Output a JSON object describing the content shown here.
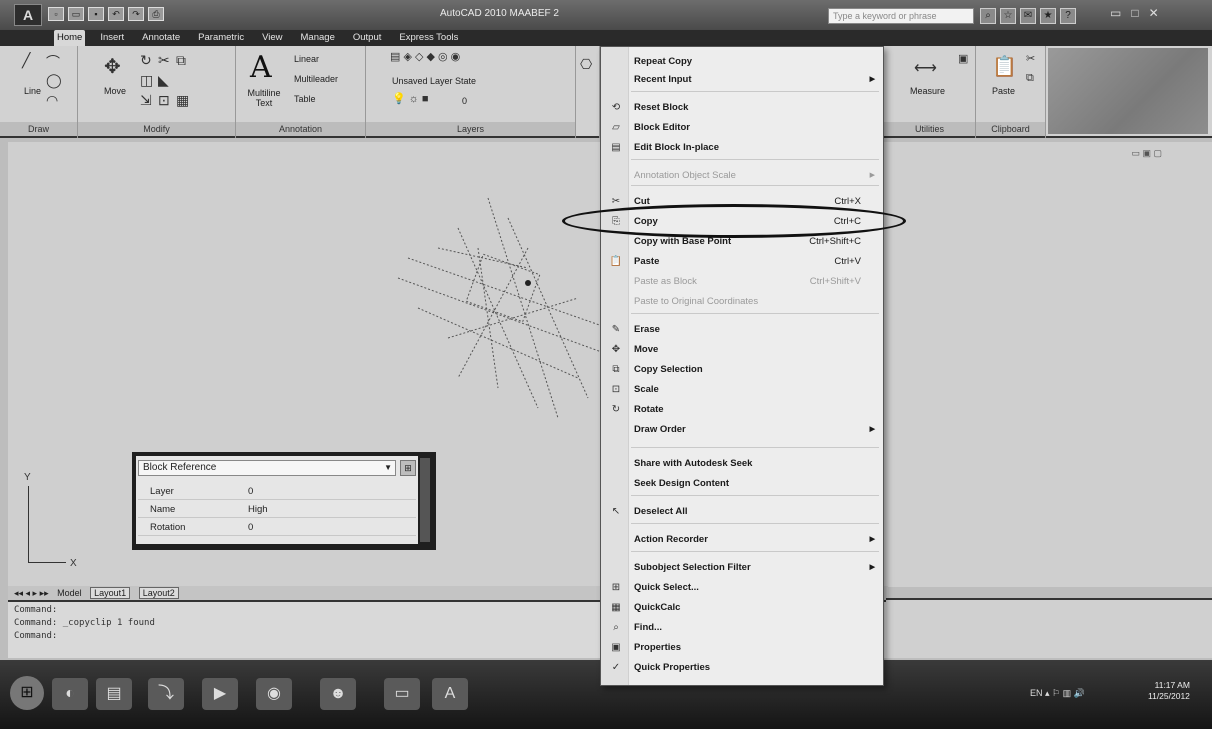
{
  "titlebar": {
    "window_title": "AutoCAD 2010  MAABEF 2",
    "search_placeholder": "Type a keyword or phrase",
    "window_controls": [
      "▭",
      "□",
      "✕"
    ]
  },
  "ribbon_tabs": [
    "Home",
    "Insert",
    "Annotate",
    "Parametric",
    "View",
    "Manage",
    "Output",
    "Express Tools"
  ],
  "ribbon": {
    "draw_tools": {
      "line": "Line"
    },
    "modify_tools": {
      "move": "Move"
    },
    "annotation_tools": {
      "multiline_text": "Multiline Text",
      "linear": "Linear",
      "multileader": "Multileader",
      "table": "Table"
    },
    "layers_tools": {
      "layer_state": "Unsaved Layer State",
      "layer_value": "0"
    },
    "utilities_tools": {
      "measure": "Measure"
    },
    "clipboard_tools": {
      "paste": "Paste"
    },
    "panels": {
      "draw": "Draw",
      "modify": "Modify",
      "annotation": "Annotation",
      "layers": "Layers",
      "utilities": "Utilities",
      "clipboard": "Clipboard"
    }
  },
  "quick_properties": {
    "selected": "Block Reference",
    "rows": [
      {
        "key": "Layer",
        "value": "0"
      },
      {
        "key": "Name",
        "value": "High"
      },
      {
        "key": "Rotation",
        "value": "0"
      }
    ]
  },
  "layout_tabs": [
    "Model",
    "Layout1",
    "Layout2"
  ],
  "command_lines": [
    "Command:",
    "Command: _copyclip 1 found",
    "Command:"
  ],
  "context_menu": {
    "items": [
      {
        "label": "Repeat Copy",
        "shortcut": "",
        "disabled": false,
        "submenu": false,
        "icon": ""
      },
      {
        "label": "Recent Input",
        "shortcut": "",
        "disabled": false,
        "submenu": true,
        "icon": ""
      },
      {
        "label": "Reset Block",
        "shortcut": "",
        "disabled": false,
        "submenu": false,
        "icon": "⟲"
      },
      {
        "label": "Block Editor",
        "shortcut": "",
        "disabled": false,
        "submenu": false,
        "icon": "▱"
      },
      {
        "label": "Edit Block In-place",
        "shortcut": "",
        "disabled": false,
        "submenu": false,
        "icon": "▤"
      },
      {
        "label": "Annotation Object Scale",
        "shortcut": "",
        "disabled": true,
        "submenu": true,
        "icon": ""
      },
      {
        "label": "Cut",
        "shortcut": "Ctrl+X",
        "disabled": false,
        "submenu": false,
        "icon": "✂"
      },
      {
        "label": "Copy",
        "shortcut": "Ctrl+C",
        "disabled": false,
        "submenu": false,
        "icon": "⎘"
      },
      {
        "label": "Copy with Base Point",
        "shortcut": "Ctrl+Shift+C",
        "disabled": false,
        "submenu": false,
        "icon": ""
      },
      {
        "label": "Paste",
        "shortcut": "Ctrl+V",
        "disabled": false,
        "submenu": false,
        "icon": "📋"
      },
      {
        "label": "Paste as Block",
        "shortcut": "Ctrl+Shift+V",
        "disabled": true,
        "submenu": false,
        "icon": ""
      },
      {
        "label": "Paste to Original Coordinates",
        "shortcut": "",
        "disabled": true,
        "submenu": false,
        "icon": ""
      },
      {
        "label": "Erase",
        "shortcut": "",
        "disabled": false,
        "submenu": false,
        "icon": "✎"
      },
      {
        "label": "Move",
        "shortcut": "",
        "disabled": false,
        "submenu": false,
        "icon": "✥"
      },
      {
        "label": "Copy Selection",
        "shortcut": "",
        "disabled": false,
        "submenu": false,
        "icon": "⧉"
      },
      {
        "label": "Scale",
        "shortcut": "",
        "disabled": false,
        "submenu": false,
        "icon": "⊡"
      },
      {
        "label": "Rotate",
        "shortcut": "",
        "disabled": false,
        "submenu": false,
        "icon": "↻"
      },
      {
        "label": "Draw Order",
        "shortcut": "",
        "disabled": false,
        "submenu": true,
        "icon": ""
      },
      {
        "label": "Share with Autodesk Seek",
        "shortcut": "",
        "disabled": false,
        "submenu": false,
        "icon": ""
      },
      {
        "label": "Seek Design Content",
        "shortcut": "",
        "disabled": false,
        "submenu": false,
        "icon": ""
      },
      {
        "label": "Deselect All",
        "shortcut": "",
        "disabled": false,
        "submenu": false,
        "icon": "↖"
      },
      {
        "label": "Action Recorder",
        "shortcut": "",
        "disabled": false,
        "submenu": true,
        "icon": ""
      },
      {
        "label": "Subobject Selection Filter",
        "shortcut": "",
        "disabled": false,
        "submenu": true,
        "icon": ""
      },
      {
        "label": "Quick Select...",
        "shortcut": "",
        "disabled": false,
        "submenu": false,
        "icon": "⊞"
      },
      {
        "label": "QuickCalc",
        "shortcut": "",
        "disabled": false,
        "submenu": false,
        "icon": "▦"
      },
      {
        "label": "Find...",
        "shortcut": "",
        "disabled": false,
        "submenu": false,
        "icon": "⌕"
      },
      {
        "label": "Properties",
        "shortcut": "",
        "disabled": false,
        "submenu": false,
        "icon": "▣"
      },
      {
        "label": "Quick Properties",
        "shortcut": "",
        "disabled": false,
        "submenu": false,
        "icon": "✓"
      }
    ]
  },
  "taskbar": {
    "clock_time": "11:17 AM",
    "clock_date": "11/25/2012"
  },
  "colors": {
    "titlebar": "#4a4a4a",
    "ribbon": "#d2d2d2",
    "drawing_bg": "#cfcfcf",
    "menu_bg": "#ededed",
    "highlight_oval": "#111111"
  }
}
